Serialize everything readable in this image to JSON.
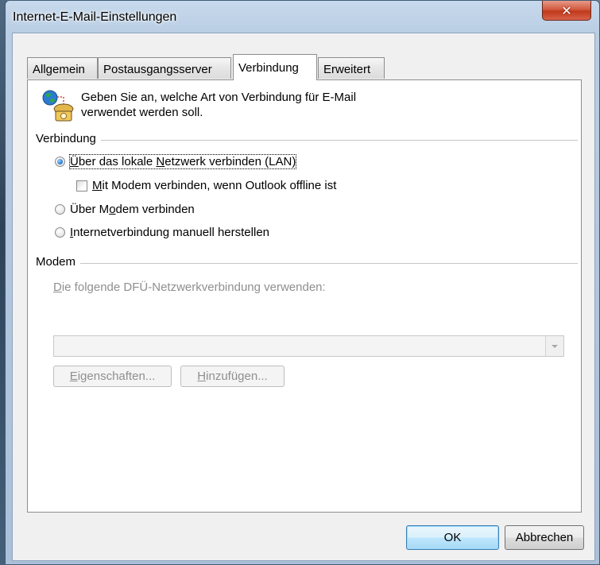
{
  "window": {
    "title": "Internet-E-Mail-Einstellungen",
    "close_glyph": "✕"
  },
  "tabs": [
    {
      "label": "Allgemein",
      "active": false
    },
    {
      "label": "Postausgangsserver",
      "active": false
    },
    {
      "label": "Verbindung",
      "active": true
    },
    {
      "label": "Erweitert",
      "active": false
    }
  ],
  "info": {
    "icon": "globe-phone-icon",
    "text_line1": "Geben Sie an, welche Art von Verbindung für E-Mail",
    "text_line2": "verwendet werden soll."
  },
  "connection_group": {
    "label": "Verbindung",
    "lan": {
      "label": "Über das lokale Netzwerk verbinden (LAN)",
      "checked": true
    },
    "modem_offline": {
      "label": "Mit Modem verbinden, wenn Outlook offline ist",
      "checked": false
    },
    "via_modem": {
      "label": "Über Modem verbinden",
      "checked": false
    },
    "manual": {
      "label": "Internetverbindung manuell herstellen",
      "checked": false
    }
  },
  "modem_group": {
    "label": "Modem",
    "dun_label": "Die folgende DFÜ-Netzwerkverbindung verwenden:",
    "dun_value": "",
    "properties_button": "Eigenschaften...",
    "add_button": "Hinzufügen..."
  },
  "buttons": {
    "ok": "OK",
    "cancel": "Abbrechen"
  },
  "colors": {
    "close_button": "#c0391b",
    "radio_checked": "#2f7fd6",
    "default_button_border": "#3c7fb1"
  }
}
